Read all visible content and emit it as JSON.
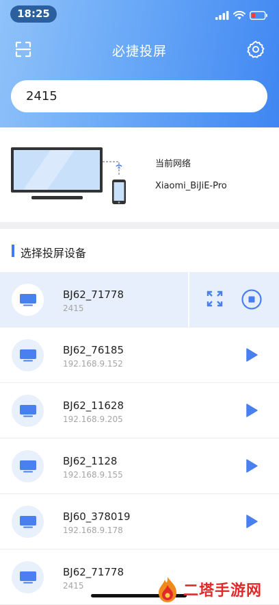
{
  "status_bar": {
    "time": "18:25"
  },
  "nav": {
    "title": "必捷投屏",
    "scan_icon": "scan-icon",
    "settings_icon": "gear-icon"
  },
  "search": {
    "value": "2415"
  },
  "network": {
    "label": "当前网络",
    "name": "Xiaomi_BiJiE-Pro"
  },
  "section": {
    "title": "选择投屏设备"
  },
  "devices": [
    {
      "name": "BJ62_71778",
      "sub": "2415",
      "state": "casting"
    },
    {
      "name": "BJ62_76185",
      "sub": "192.168.9.152",
      "state": "idle"
    },
    {
      "name": "BJ62_11628",
      "sub": "192.168.9.205",
      "state": "idle"
    },
    {
      "name": "BJ62_1128",
      "sub": "192.168.9.155",
      "state": "idle"
    },
    {
      "name": "BJ60_378019",
      "sub": "192.168.9.178",
      "state": "idle"
    },
    {
      "name": "BJ62_71778",
      "sub": "2415",
      "state": "idle"
    }
  ],
  "watermark": {
    "text": "二塔手游网"
  },
  "colors": {
    "accent": "#3d7cf2",
    "header_start": "#8fc2f9",
    "header_end": "#3f86f2",
    "active_row": "#e6effb"
  }
}
